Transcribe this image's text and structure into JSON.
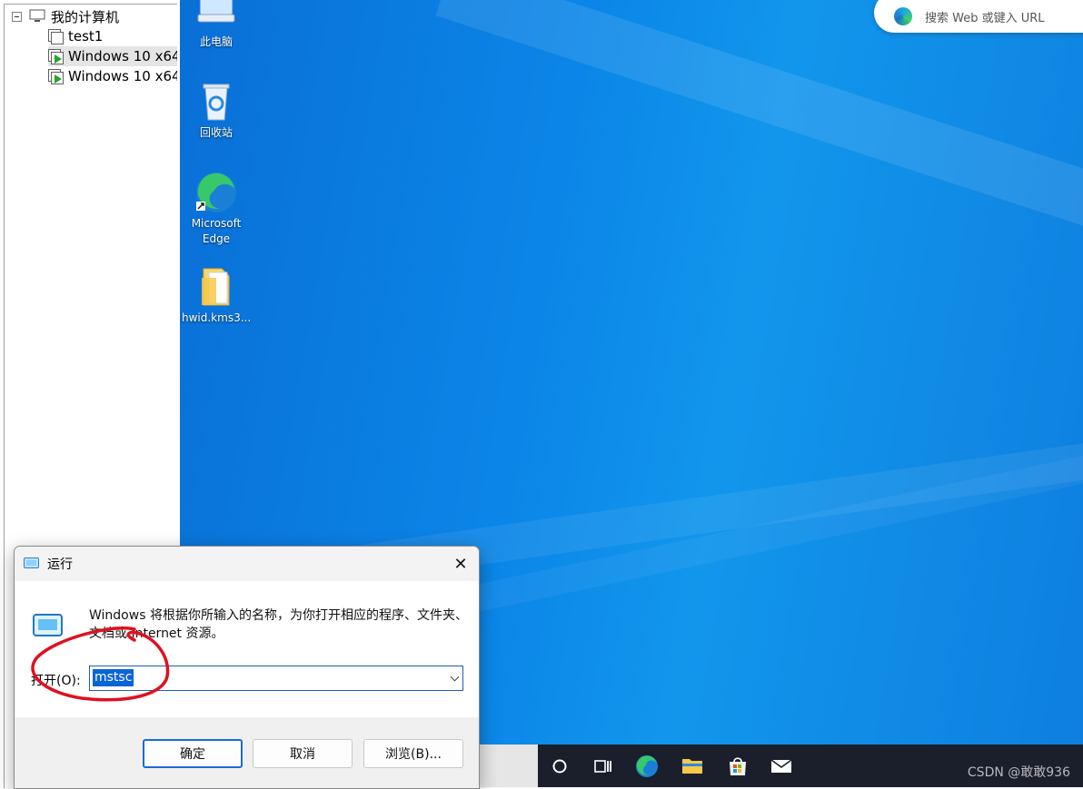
{
  "tree": {
    "root_label": "我的计算机",
    "items": [
      {
        "label": "test1",
        "running": false
      },
      {
        "label": "Windows 10 x64",
        "running": true
      },
      {
        "label": "Windows 10 x64",
        "running": true
      }
    ]
  },
  "desktop": {
    "icons": [
      {
        "label": "此电脑",
        "icon": "pc-icon"
      },
      {
        "label": "回收站",
        "icon": "recycle-bin-icon"
      },
      {
        "label": "Microsoft Edge",
        "icon": "edge-icon"
      },
      {
        "label": "hwid.kms3...",
        "icon": "folder-icon"
      }
    ],
    "colors": {
      "background": "#0b86e8"
    }
  },
  "search": {
    "placeholder": "搜索 Web 或键入 URL"
  },
  "taskbar": {
    "items": [
      "search-circle-icon",
      "task-view-icon",
      "edge-icon",
      "file-explorer-icon",
      "store-icon",
      "mail-icon"
    ],
    "watermark": "CSDN @敢敢936"
  },
  "run_dialog": {
    "title": "运行",
    "description": "Windows 将根据你所输入的名称，为你打开相应的程序、文件夹、文档或 Internet 资源。",
    "open_label": "打开(O):",
    "input_value": "mstsc",
    "buttons": {
      "ok": "确定",
      "cancel": "取消",
      "browse": "浏览(B)..."
    },
    "colors": {
      "selection": "#0a64d6",
      "annotation": "#e01020"
    }
  }
}
